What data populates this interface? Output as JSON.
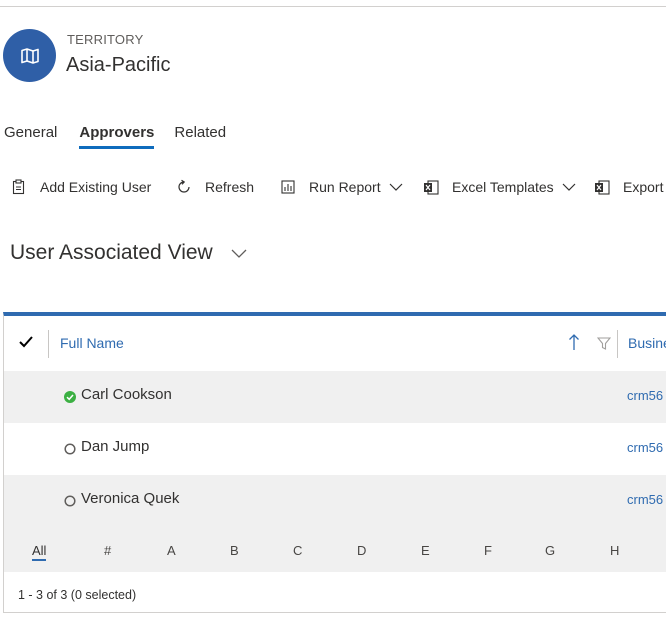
{
  "header": {
    "entity_type": "TERRITORY",
    "entity_name": "Asia-Pacific",
    "icon": "map-icon",
    "icon_color": "#2f5fa7"
  },
  "tabs": [
    {
      "label": "General",
      "active": false
    },
    {
      "label": "Approvers",
      "active": true
    },
    {
      "label": "Related",
      "active": false
    }
  ],
  "commands": [
    {
      "label": "Add Existing User",
      "icon": "add-user-icon"
    },
    {
      "label": "Refresh",
      "icon": "refresh-icon"
    },
    {
      "label": "Run Report",
      "icon": "report-icon",
      "dropdown": true
    },
    {
      "label": "Excel Templates",
      "icon": "excel-icon",
      "dropdown": true
    },
    {
      "label": "Export",
      "icon": "export-excel-icon"
    }
  ],
  "view": {
    "title": "User Associated View"
  },
  "grid": {
    "columns": [
      {
        "label": "Full Name",
        "sorted": "ascending"
      },
      {
        "label": "Busine"
      }
    ],
    "rows": [
      {
        "full_name": "Carl Cookson",
        "status": "active",
        "business_unit": "crm56"
      },
      {
        "full_name": "Dan Jump",
        "status": "inactive",
        "business_unit": "crm56"
      },
      {
        "full_name": "Veronica Quek",
        "status": "inactive",
        "business_unit": "crm56"
      }
    ],
    "jump_letters": [
      "All",
      "#",
      "A",
      "B",
      "C",
      "D",
      "E",
      "F",
      "G",
      "H"
    ],
    "active_jump": "All",
    "footer": "1 - 3 of 3 (0 selected)"
  },
  "colors": {
    "accent": "#2f6bb0",
    "active_status": "#3cb043",
    "tab_underline": "#0f6cbd"
  }
}
